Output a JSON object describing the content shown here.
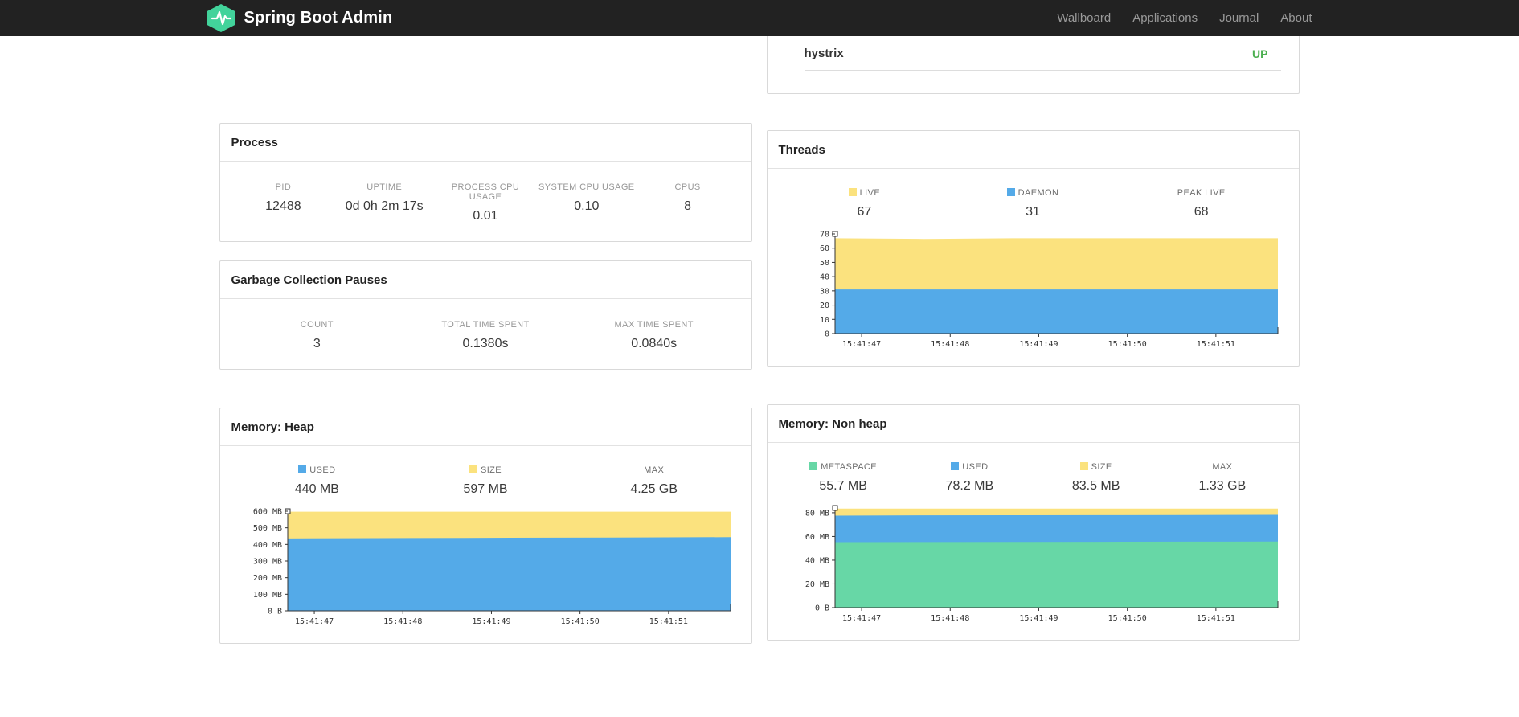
{
  "navbar": {
    "brand": "Spring Boot Admin",
    "links": [
      "Wallboard",
      "Applications",
      "Journal",
      "About"
    ]
  },
  "application": {
    "name": "hystrix",
    "status": "UP"
  },
  "panels": {
    "process": {
      "title": "Process",
      "stats": [
        {
          "label": "PID",
          "value": "12488"
        },
        {
          "label": "UPTIME",
          "value": "0d 0h 2m 17s"
        },
        {
          "label": "PROCESS CPU USAGE",
          "value": "0.01"
        },
        {
          "label": "SYSTEM CPU USAGE",
          "value": "0.10"
        },
        {
          "label": "CPUS",
          "value": "8"
        }
      ]
    },
    "gc": {
      "title": "Garbage Collection Pauses",
      "stats": [
        {
          "label": "COUNT",
          "value": "3"
        },
        {
          "label": "TOTAL TIME SPENT",
          "value": "0.1380s"
        },
        {
          "label": "MAX TIME SPENT",
          "value": "0.0840s"
        }
      ]
    },
    "threads": {
      "title": "Threads",
      "legend": [
        {
          "label": "LIVE",
          "value": "67",
          "color": "#fbe27e"
        },
        {
          "label": "DAEMON",
          "value": "31",
          "color": "#54aae8"
        },
        {
          "label": "PEAK LIVE",
          "value": "68",
          "color": ""
        }
      ]
    },
    "heap": {
      "title": "Memory: Heap",
      "legend": [
        {
          "label": "USED",
          "value": "440 MB",
          "color": "#54aae8"
        },
        {
          "label": "SIZE",
          "value": "597 MB",
          "color": "#fbe27e"
        },
        {
          "label": "MAX",
          "value": "4.25 GB",
          "color": ""
        }
      ]
    },
    "nonheap": {
      "title": "Memory: Non heap",
      "legend": [
        {
          "label": "METASPACE",
          "value": "55.7 MB",
          "color": "#67d7a6"
        },
        {
          "label": "USED",
          "value": "78.2 MB",
          "color": "#54aae8"
        },
        {
          "label": "SIZE",
          "value": "83.5 MB",
          "color": "#fbe27e"
        },
        {
          "label": "MAX",
          "value": "1.33 GB",
          "color": ""
        }
      ]
    }
  },
  "chart_data": [
    {
      "id": "threads",
      "type": "area",
      "title": "Threads",
      "x_labels": [
        "15:41:47",
        "15:41:48",
        "15:41:49",
        "15:41:50",
        "15:41:51"
      ],
      "ylim": [
        0,
        70
      ],
      "yticks": [
        0,
        10,
        20,
        30,
        40,
        50,
        60,
        70
      ],
      "ytick_labels": [
        "0",
        "10",
        "20",
        "30",
        "40",
        "50",
        "60",
        "70"
      ],
      "series": [
        {
          "name": "LIVE",
          "color": "#fbe27e",
          "values": [
            67,
            66.5,
            67,
            67,
            67,
            67
          ]
        },
        {
          "name": "DAEMON",
          "color": "#54aae8",
          "values": [
            31,
            31,
            31,
            31,
            31,
            31
          ]
        }
      ],
      "grid": false,
      "legend_position": "top"
    },
    {
      "id": "heap",
      "type": "area",
      "title": "Memory: Heap",
      "x_labels": [
        "15:41:47",
        "15:41:48",
        "15:41:49",
        "15:41:50",
        "15:41:51"
      ],
      "ylim": [
        0,
        600
      ],
      "yticks": [
        0,
        100,
        200,
        300,
        400,
        500,
        600
      ],
      "ytick_labels": [
        "0 B",
        "100 MB",
        "200 MB",
        "300 MB",
        "400 MB",
        "500 MB",
        "600 MB"
      ],
      "series": [
        {
          "name": "SIZE",
          "color": "#fbe27e",
          "values": [
            597,
            597,
            597,
            597,
            597,
            597
          ]
        },
        {
          "name": "USED",
          "color": "#54aae8",
          "values": [
            436,
            438,
            439,
            441,
            442,
            444
          ]
        }
      ],
      "grid": false,
      "legend_position": "top"
    },
    {
      "id": "nonheap",
      "type": "area",
      "title": "Memory: Non heap",
      "x_labels": [
        "15:41:47",
        "15:41:48",
        "15:41:49",
        "15:41:50",
        "15:41:51"
      ],
      "ylim": [
        0,
        84
      ],
      "yticks": [
        0,
        20,
        40,
        60,
        80
      ],
      "ytick_labels": [
        "0 B",
        "20 MB",
        "40 MB",
        "60 MB",
        "80 MB"
      ],
      "series": [
        {
          "name": "SIZE",
          "color": "#fbe27e",
          "values": [
            83.5,
            83.5,
            83.5,
            83.5,
            83.5,
            83.5
          ]
        },
        {
          "name": "USED",
          "color": "#54aae8",
          "values": [
            77.6,
            77.8,
            77.9,
            78.0,
            78.1,
            78.2
          ]
        },
        {
          "name": "METASPACE",
          "color": "#67d7a6",
          "values": [
            55.2,
            55.3,
            55.4,
            55.5,
            55.6,
            55.7
          ]
        }
      ],
      "grid": false,
      "legend_position": "top"
    }
  ],
  "colors": {
    "status_up": "#4CAF50",
    "navbar_bg": "#222222",
    "logo": "#42d39b",
    "area_yellow": "#fbe27e",
    "area_blue": "#54aae8",
    "area_green": "#67d7a6"
  }
}
